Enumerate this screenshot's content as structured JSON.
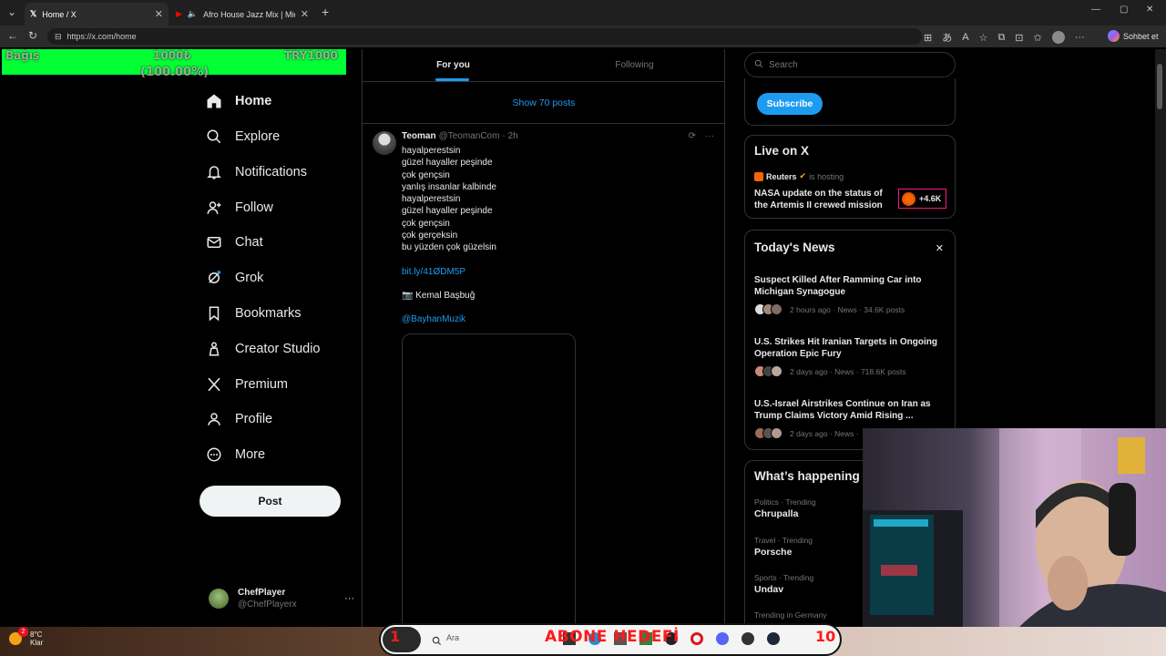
{
  "browser": {
    "tabs": [
      {
        "label": "Home / X",
        "active": true
      },
      {
        "label": "Afro House Jazz Mix | Midnigh",
        "active": false
      }
    ],
    "url": "https://x.com/home",
    "copilot_label": "Sohbet et"
  },
  "donation": {
    "label": "Bağış",
    "amount": "1000₺",
    "goal": "TRY1000",
    "percent": "(100.00%)",
    "progress": 1.0
  },
  "nav": {
    "items": [
      {
        "label": "Home",
        "icon": "home-icon"
      },
      {
        "label": "Explore",
        "icon": "search-icon"
      },
      {
        "label": "Notifications",
        "icon": "bell-icon"
      },
      {
        "label": "Follow",
        "icon": "person-add-icon"
      },
      {
        "label": "Chat",
        "icon": "mail-icon"
      },
      {
        "label": "Grok",
        "icon": "grok-icon"
      },
      {
        "label": "Bookmarks",
        "icon": "bookmark-icon"
      },
      {
        "label": "Creator Studio",
        "icon": "creator-icon"
      },
      {
        "label": "Premium",
        "icon": "x-logo-icon"
      },
      {
        "label": "Profile",
        "icon": "person-icon"
      },
      {
        "label": "More",
        "icon": "more-circle-icon"
      }
    ],
    "post_label": "Post"
  },
  "account": {
    "name": "ChefPlayer",
    "handle": "@ChefPlayerx",
    "menu": "···"
  },
  "feed": {
    "tab_for_you": "For you",
    "tab_following": "Following",
    "show_posts": "Show 70 posts",
    "tweet": {
      "name": "Teoman",
      "handle": "@TeomanCom",
      "time": "· 2h",
      "lines": [
        "hayalperestsin",
        "güzel hayaller peşinde",
        "çok gençsin",
        "yanlış insanlar kalbinde",
        "hayalperestsin",
        "güzel hayaller peşinde",
        "çok gençsin",
        "çok gerçeksin",
        "bu yüzden çok güzelsin"
      ],
      "link": "bit.ly/41ØDM5P",
      "credit": "Kemal Başbuğ",
      "mention": "@BayhanMuzik"
    }
  },
  "sidebar": {
    "search_placeholder": "Search",
    "subscribe_label": "Subscribe",
    "live": {
      "title": "Live on X",
      "host": "Reuters",
      "hosting": "is hosting",
      "headline": "NASA update on the status of the Artemis II crewed mission",
      "count": "+4.6K"
    },
    "news": {
      "title": "Today's News",
      "close": "✕",
      "items": [
        {
          "title": "Suspect Killed After Ramming Car into Michigan Synagogue",
          "meta": "2 hours ago · News · 34.6K posts"
        },
        {
          "title": "U.S. Strikes Hit Iranian Targets in Ongoing Operation Epic Fury",
          "meta": "2 days ago · News · 718.6K posts"
        },
        {
          "title": "U.S.-Israel Airstrikes Continue on Iran as Trump Claims Victory Amid Rising ...",
          "meta": "2 days ago · News ·"
        }
      ]
    },
    "happening": {
      "title": "What’s happening",
      "trends": [
        {
          "category": "Politics · Trending",
          "name": "Chrupalla"
        },
        {
          "category": "Travel · Trending",
          "name": "Porsche"
        },
        {
          "category": "Sports · Trending",
          "name": "Undav"
        },
        {
          "category": "Trending in Germany",
          "name": ""
        }
      ]
    }
  },
  "taskbar": {
    "weather_temp": "8°C",
    "weather_desc": "Klar",
    "weather_badge": "2",
    "search_placeholder": "Ara",
    "goal_text": "ABONE HEDEFİ",
    "goal_left": "1",
    "goal_right": "10"
  },
  "colors": {
    "accent": "#1d9bf0",
    "donation_bar": "#00ff33",
    "goal_red": "#ff1a1a"
  }
}
